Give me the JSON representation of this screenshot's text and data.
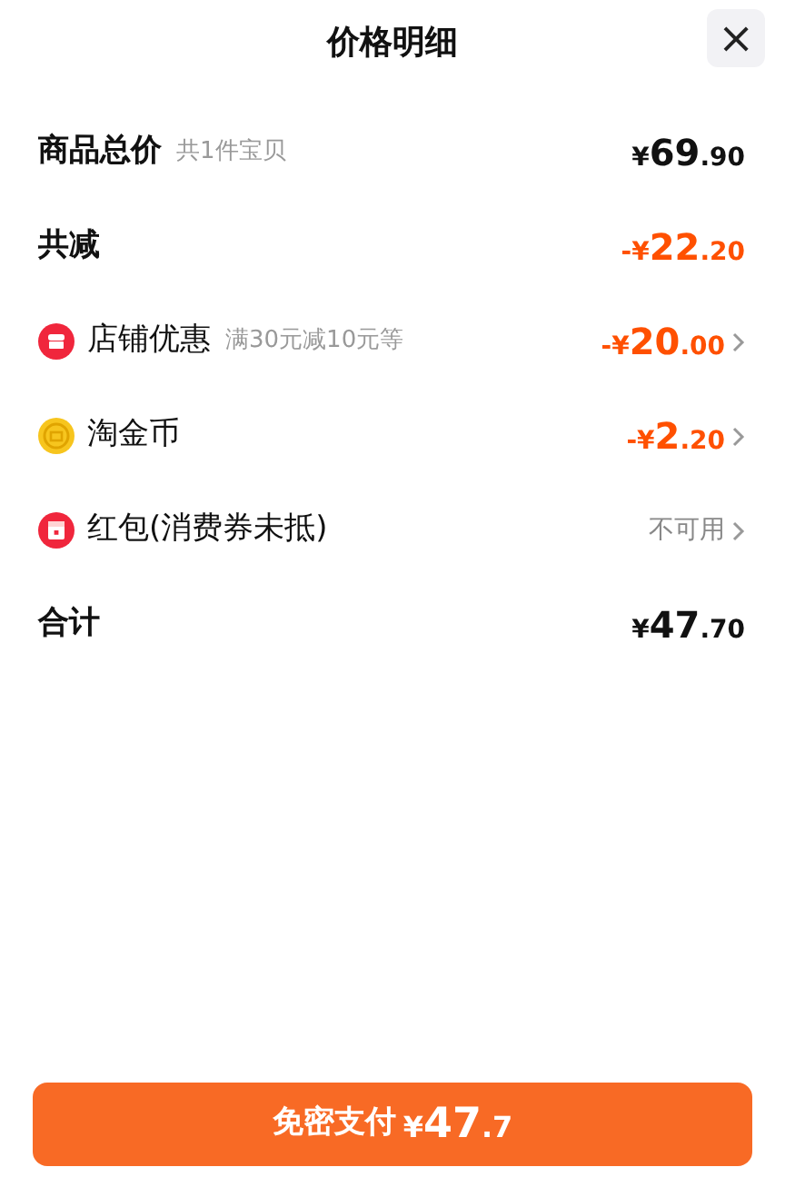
{
  "header": {
    "title": "价格明细",
    "close": "×"
  },
  "rows": [
    {
      "kind": "plain",
      "label": "商品总价",
      "note": "共1件宝贝",
      "discount": false,
      "amount": {
        "prefix": "¥",
        "integer": "69",
        "fraction": ".90"
      },
      "has_arrow": false
    },
    {
      "kind": "plain",
      "label": "共减",
      "discount": true,
      "amount": {
        "prefix": "-¥",
        "integer": "22",
        "fraction": ".20"
      },
      "has_arrow": false
    },
    {
      "kind": "shop",
      "label": "店铺优惠",
      "note": "满30元减10元等",
      "discount": true,
      "amount": {
        "prefix": "-¥",
        "integer": "20",
        "fraction": ".00"
      },
      "has_arrow": true
    },
    {
      "kind": "coin",
      "label": "淘金币",
      "discount": true,
      "amount": {
        "prefix": "-¥",
        "integer": "2",
        "fraction": ".20"
      },
      "has_arrow": true
    },
    {
      "kind": "redpacket",
      "label": "红包(消费券未抵)",
      "status": "不可用",
      "has_arrow": true
    },
    {
      "kind": "plain",
      "label": "合计",
      "discount": false,
      "amount": {
        "prefix": "¥",
        "integer": "47",
        "fraction": ".70"
      },
      "has_arrow": false
    }
  ],
  "pay_button": {
    "label": "免密支付",
    "amount": {
      "prefix": "¥",
      "integer": "47",
      "fraction": ".7"
    }
  }
}
